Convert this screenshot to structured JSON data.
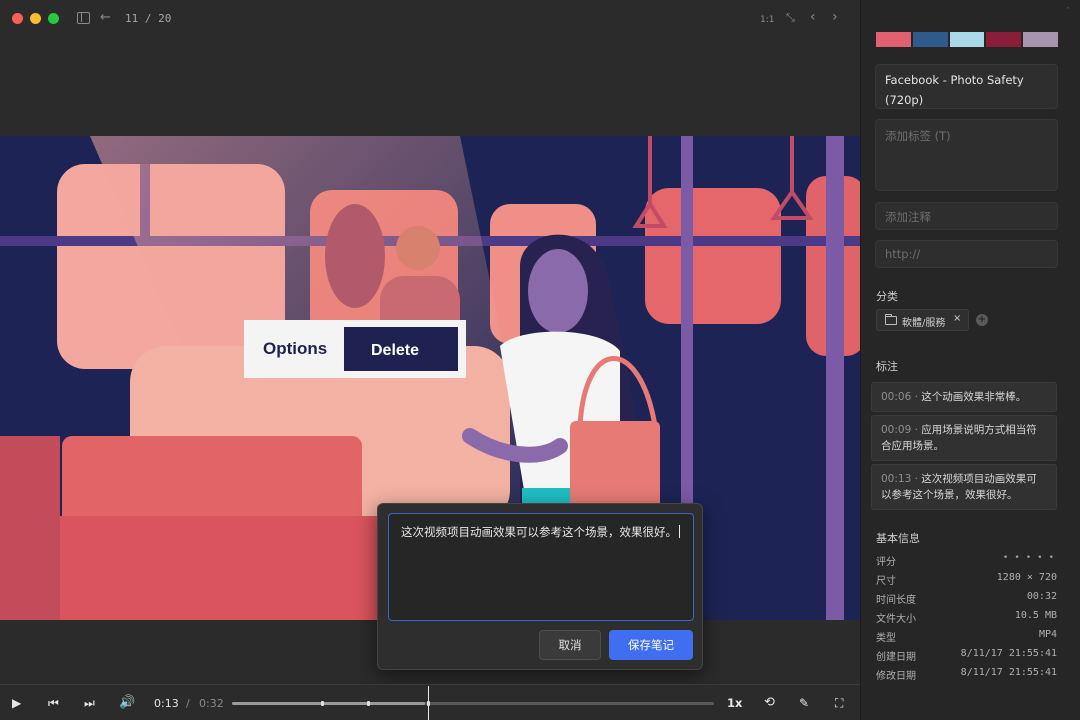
{
  "titlebar": {
    "page_counter": "11 / 20",
    "actual_size_label": "1:1"
  },
  "illustration": {
    "options_label": "Options",
    "delete_label": "Delete"
  },
  "note_editor": {
    "text": "这次视频项目动画效果可以参考这个场景，效果很好。",
    "cancel_label": "取消",
    "save_label": "保存笔记"
  },
  "player": {
    "time_current": "0:13",
    "time_separator": "/",
    "time_total": "0:32",
    "progress": 0.4,
    "markers": [
      0.1875,
      0.28125,
      0.40625
    ],
    "speed_label": "1x"
  },
  "inspector": {
    "palette": [
      "#e06270",
      "#2e5a8c",
      "#a9d8e8",
      "#8a1e38",
      "#a695ac"
    ],
    "title": "Facebook - Photo Safety (720p)",
    "tags_placeholder": "添加标签 (T)",
    "annotation_placeholder": "添加注释",
    "url_placeholder": "http://",
    "category_label": "分类",
    "category_chip": "軟體/服務",
    "category_chip_remove": "×",
    "notes_label": "标注",
    "notes": [
      {
        "time": "00:06",
        "text": "这个动画效果非常棒。"
      },
      {
        "time": "00:09",
        "text": "应用场景说明方式相当符合应用场景。"
      },
      {
        "time": "00:13",
        "text": "这次视频项目动画效果可以参考这个场景，效果很好。"
      }
    ],
    "info_label": "基本信息",
    "info": {
      "rating_key": "评分",
      "rating_value": 0,
      "rating_max": 5,
      "dimensions_key": "尺寸",
      "dimensions_value": "1280 × 720",
      "duration_key": "时间长度",
      "duration_value": "00:32",
      "filesize_key": "文件大小",
      "filesize_value": "10.5 MB",
      "type_key": "类型",
      "type_value": "MP4",
      "created_key": "创建日期",
      "created_value": "8/11/17 21:55:41",
      "modified_key": "修改日期",
      "modified_value": "8/11/17 21:55:41"
    }
  }
}
